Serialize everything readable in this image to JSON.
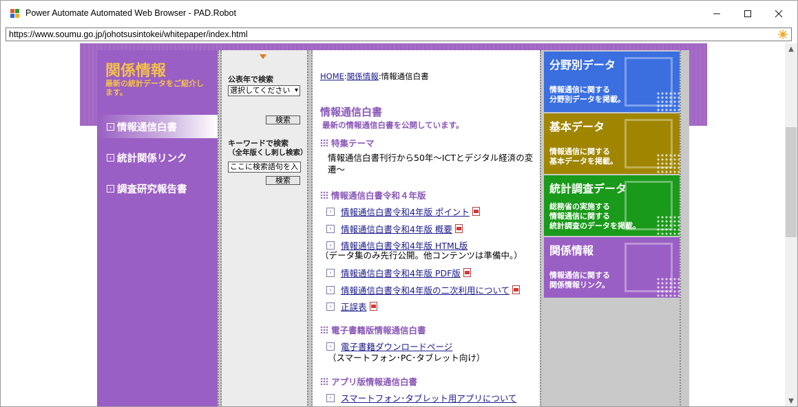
{
  "window": {
    "title": "Power Automate Automated Web Browser - PAD.Robot",
    "address": "https://www.soumu.go.jp/johotsusintokei/whitepaper/index.html"
  },
  "colors": {
    "purple": "#9a5fc4",
    "accent": "#f4c04a",
    "heading": "#8a58b8",
    "link": "#1a1a8a"
  },
  "left": {
    "title": "関係情報",
    "subtitle": "最新の統計データをご紹介します。",
    "nav": [
      {
        "label": "情報通信白書",
        "active": true
      },
      {
        "label": "統計関係リンク"
      },
      {
        "label": "調査研究報告書"
      }
    ]
  },
  "search": {
    "year_label": "公表年で検索",
    "year_select": "選択してください",
    "search_btn": "検索",
    "keyword_label": "キーワードで検索",
    "keyword_sub": "（全年版くし刺し検索）",
    "keyword_value": "ここに検索語句を入",
    "search_btn2": "検索"
  },
  "main": {
    "breadcrumb": {
      "home": "HOME",
      "sep1": ":",
      "rel": "関係情報",
      "sep2": ":",
      "current": "情報通信白書"
    },
    "title": "情報通信白書",
    "subtitle": "最新の情報通信白書を公開しています。",
    "sec1": {
      "title": "特集テーマ",
      "text": "情報通信白書刊行から50年～ICTとデジタル経済の変遷～"
    },
    "sec2": {
      "title": "情報通信白書令和４年版",
      "links": [
        {
          "label": "情報通信白書令和4年版 ポイント",
          "pdf": true
        },
        {
          "label": "情報通信白書令和4年版 概要",
          "pdf": true
        },
        {
          "label": "情報通信白書令和4年版 HTML版",
          "pdf": false
        },
        {
          "label": "情報通信白書令和4年版 PDF版",
          "pdf": true
        },
        {
          "label": "情報通信白書令和4年版の二次利用について",
          "pdf": true
        },
        {
          "label": "正誤表",
          "pdf": true
        }
      ],
      "note": "（データ集のみ先行公開。他コンテンツは準備中。）"
    },
    "sec3": {
      "title": "電子書籍版情報通信白書",
      "link": "電子書籍ダウンロードページ",
      "note": "（スマートフォン･PC･タブレット向け）"
    },
    "sec4": {
      "title": "アプリ版情報通信白書",
      "link": "スマートフォン･タブレット用アプリについて"
    }
  },
  "tiles": [
    {
      "title": "分野別データ",
      "desc1": "情報通信に関する",
      "desc2": "分野別データを掲載。",
      "desc3": "",
      "color": "#3b6fe0"
    },
    {
      "title": "基本データ",
      "desc1": "情報通信に関する",
      "desc2": "基本データを掲載。",
      "desc3": "",
      "color": "#a08600"
    },
    {
      "title": "統計調査データ",
      "desc1": "総務省の実施する",
      "desc2": "情報通信に関する",
      "desc3": "統計調査のデータを掲載。",
      "color": "#1a9a1a"
    },
    {
      "title": "関係情報",
      "desc1": "情報通信に関する",
      "desc2": "関係情報リンク。",
      "desc3": "",
      "color": "#9a5fc4"
    }
  ]
}
